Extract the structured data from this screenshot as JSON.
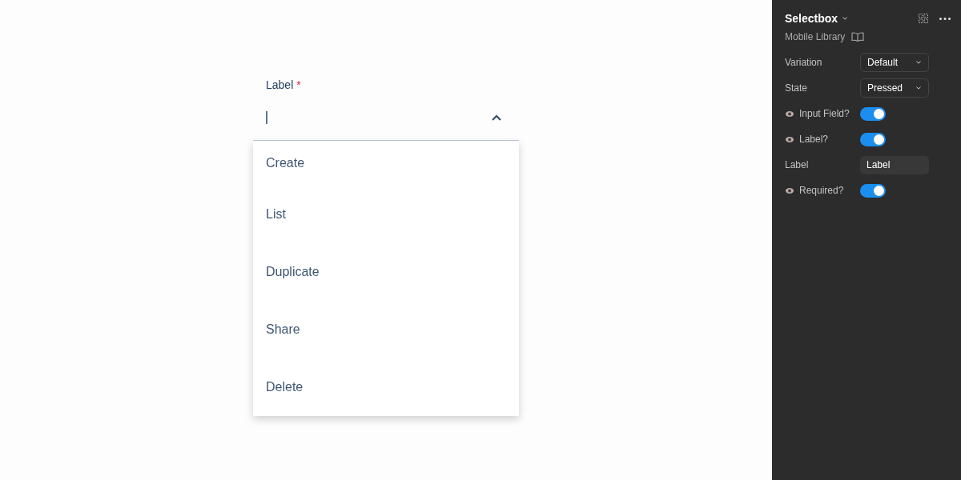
{
  "canvas": {
    "select": {
      "label": "Label",
      "required_mark": "*",
      "focused": true,
      "expanded": true,
      "options": [
        {
          "label": "Create",
          "selected": false
        },
        {
          "label": "List",
          "selected": false
        },
        {
          "label": "Duplicate",
          "selected": false
        },
        {
          "label": "Share",
          "selected": false
        },
        {
          "label": "Delete",
          "selected": false
        }
      ]
    }
  },
  "panel": {
    "title": "Selectbox",
    "library": "Mobile Library",
    "properties": [
      {
        "kind": "dropdown",
        "label": "Variation",
        "value": "Default"
      },
      {
        "kind": "dropdown",
        "label": "State",
        "value": "Pressed"
      },
      {
        "kind": "toggle",
        "label": "Input Field?",
        "on": true
      },
      {
        "kind": "toggle",
        "label": "Label?",
        "on": true
      },
      {
        "kind": "text",
        "label": "Label",
        "value": "Label"
      },
      {
        "kind": "toggle",
        "label": "Required?",
        "on": true
      }
    ]
  }
}
